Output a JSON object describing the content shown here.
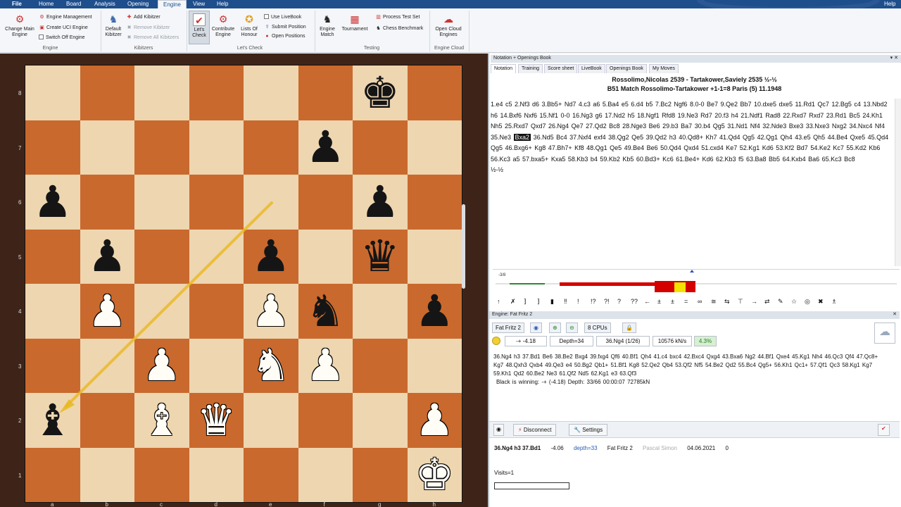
{
  "menu": {
    "items": [
      "File",
      "Home",
      "Board",
      "Analysis",
      "Opening",
      "Engine",
      "View",
      "Help"
    ],
    "help": "Help"
  },
  "ribbon": {
    "change_engine": "Change Main Engine",
    "engine_mgmt": "Engine Management",
    "create_uci": "Create UCI Engine",
    "switch_off": "Switch Off Engine",
    "group_engine": "Engine",
    "default_kibitzer": "Default Kibitzer",
    "add_kibitzer": "Add Kibitzer",
    "remove_kibitzer": "Remove Kibitzer",
    "remove_all": "Remove All Kibitzers",
    "group_kibitzers": "Kibitzers",
    "lets_check": "Let's Check",
    "contribute": "Contribute Engine",
    "honour": "Lists Of Honour",
    "use_livebook": "Use LiveBook",
    "submit_position": "Submit Position",
    "open_positions": "Open Positions",
    "group_letscheck": "Let's Check",
    "engine_match": "Engine Match",
    "tournament": "Tournament",
    "process_test": "Process Test Set",
    "chess_benchmark": "Chess Benchmark",
    "group_testing": "Testing",
    "open_cloud": "Open Cloud Engines",
    "group_cloud": "Engine Cloud"
  },
  "board": {
    "rows": [
      [
        "",
        "",
        "",
        "",
        "",
        "",
        "bK",
        ""
      ],
      [
        "",
        "",
        "",
        "",
        "",
        "bP",
        "",
        ""
      ],
      [
        "bP",
        "",
        "",
        "",
        "",
        "",
        "bP",
        ""
      ],
      [
        "",
        "bP",
        "",
        "",
        "bP",
        "",
        "bQ",
        ""
      ],
      [
        "",
        "wP",
        "",
        "",
        "wP",
        "bN",
        "",
        "bP"
      ],
      [
        "",
        "",
        "wP",
        "",
        "wN",
        "wP",
        "",
        ""
      ],
      [
        "bB",
        "",
        "wB",
        "wQ",
        "",
        "",
        "",
        "wP"
      ],
      [
        "",
        "",
        "",
        "",
        "",
        "",
        "",
        "wK"
      ]
    ],
    "ranks": [
      "8",
      "7",
      "6",
      "5",
      "4",
      "3",
      "2",
      "1"
    ],
    "files": [
      "a",
      "b",
      "c",
      "d",
      "e",
      "f",
      "g",
      "h"
    ]
  },
  "notation": {
    "title": "Notation + Openings Book",
    "tabs": [
      "Notation",
      "Training",
      "Score sheet",
      "LiveBook",
      "Openings Book",
      "My Moves"
    ],
    "header1": "Rossolimo,Nicolas 2539 - Tartakower,Saviely 2535  ½-½",
    "header2": "B51 Match Rossolimo-Tartakower +1-1=8 Paris (5) 11.1948",
    "moves_before": "1.e4 c5 2.Nf3 d6 3.Bb5+ Nd7 4.c3 a6 5.Ba4 e5 6.d4 b5 7.Bc2 Ngf6 8.0-0 Be7 9.Qe2 Bb7 10.dxe5 dxe5 11.Rd1 Qc7 12.Bg5 c4 13.Nbd2 h6 14.Bxf6 Nxf6 15.Nf1 0-0 16.Ng3 g6 17.Nd2 h5 18.Ngf1 Rfd8 19.Ne3 Rd7 20.f3 h4 21.Ndf1 Rad8 22.Rxd7 Rxd7 23.Rd1 Bc5 24.Kh1 Nh5 25.Rxd7 Qxd7 26.Ng4 Qe7 27.Qd2 Bc8 28.Nge3 Be6 29.b3 Ba7 30.b4 Qg5 31.Nd1 Nf4 32.Nde3 Bxe3 33.Nxe3 Nxg2 34.Nxc4 Nf4 35.Ne3",
    "current_move": "Bxa2",
    "moves_after": "36.Nd5 Bc4 37.Nxf4 exf4 38.Qg2 Qe5 39.Qd2 h3 40.Qd8+ Kh7 41.Qd4 Qg5 42.Qg1 Qh4 43.e5 Qh5 44.Be4 Qxe5 45.Qd4 Qg5 46.Bxg6+ Kg8 47.Bh7+ Kf8 48.Qg1 Qe5 49.Be4 Be6 50.Qd4 Qxd4 51.cxd4 Ke7 52.Kg1 Kd6 53.Kf2 Bd7 54.Ke2 Kc7 55.Kd2 Kb6 56.Kc3 a5 57.bxa5+ Kxa5 58.Kb3 b4 59.Kb2 Kb5 60.Bd3+ Kc6 61.Be4+ Kd6 62.Kb3 f5 63.Ba8 Bb5 64.Kxb4 Ba6 65.Kc3 Bc8",
    "result": "½-½"
  },
  "graph": {
    "label": "-3/8"
  },
  "annotations": [
    "↑",
    "✗",
    "⁆",
    "⁆",
    "▮",
    "‼",
    "!",
    "!?",
    "?!",
    "?",
    "??",
    "←",
    "±",
    "±",
    "=",
    "∞",
    "≅",
    "⇆",
    "⊤",
    "→",
    "⇄",
    "✎",
    "☆",
    "◎",
    "✖",
    "♗"
  ],
  "engine": {
    "title": "Engine: Fat Fritz 2",
    "name": "Fat Fritz 2",
    "cpus": "8 CPUs",
    "eval": "-+ -4.18",
    "depth": "Depth=34",
    "move": "36.Ng4 (1/26)",
    "speed": "10576 kN/s",
    "pct": "4.3%",
    "pv": "36.Ng4 h3 37.Bd1 Be6 38.Be2 Bxg4 39.fxg4 Qf6 40.Bf1 Qh4 41.c4 bxc4 42.Bxc4 Qxg4 43.Bxa6 Ng2 44.Bf1 Qxe4 45.Kg1 Nh4 46.Qc3 Qf4 47.Qc8+ Kg7 48.Qxh3 Qxb4 49.Qe3 e4 50.Bg2 Qb1+ 51.Bf1 Kg8 52.Qe2 Qb4 53.Qf2 Nf5 54.Be2 Qd2 55.Bc4 Qg5+ 56.Kh1 Qc1+ 57.Qf1 Qc3 58.Kg1 Kg7 59.Kh1 Qd2 60.Be2 Ne3 61.Qf2 Nd5 62.Kg1 e3 63.Qf3",
    "status": "Black is winning: -+ (-4.18)  Depth: 33/66  00:00:07  72785kN"
  },
  "kibitzer": {
    "disconnect": "Disconnect",
    "settings": "Settings",
    "line_move": "36.Ng4 h3 37.Bd1",
    "line_eval": "-4.06",
    "line_depth": "depth=33",
    "line_engine": "Fat Fritz 2",
    "line_user": "Pascal Simon",
    "line_date": "04.06.2021",
    "line_zero": "0",
    "visits": "Visits=1"
  },
  "colors": {
    "light_square": "#eed6b0",
    "dark_square": "#c9692e",
    "menubar": "#1f4e8c",
    "arrow": "#e8b820"
  }
}
